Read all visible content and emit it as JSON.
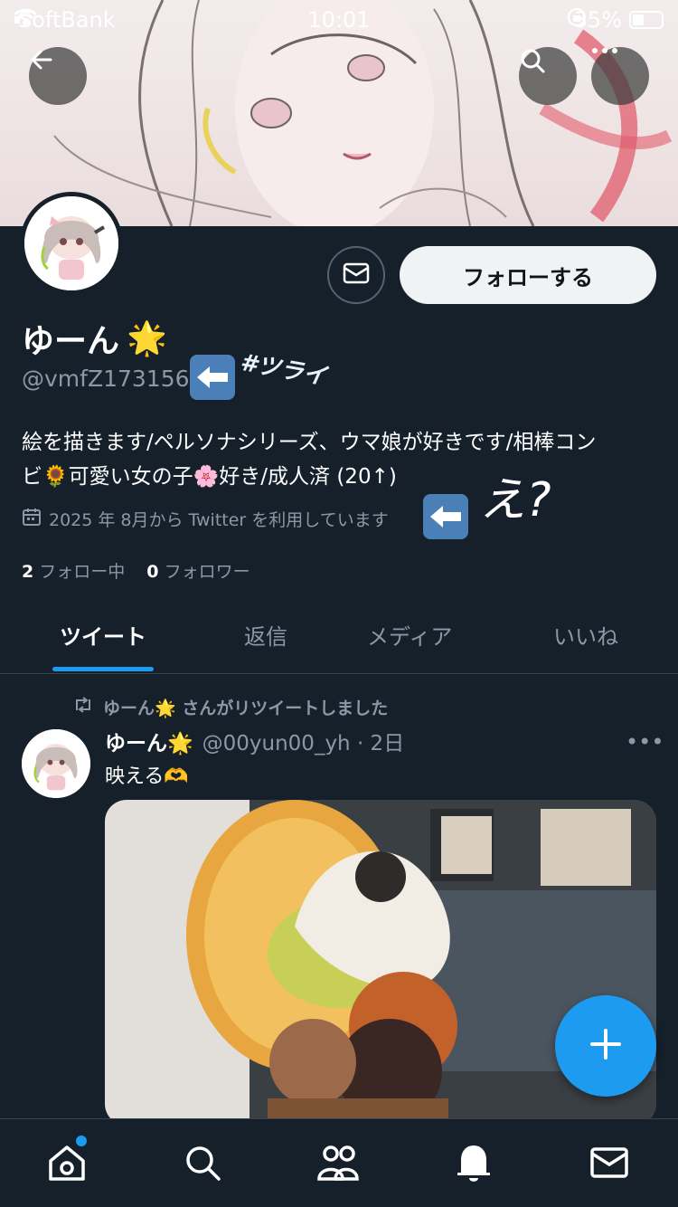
{
  "status_bar": {
    "carrier": "SoftBank",
    "time": "10:01",
    "battery": "35%"
  },
  "profile": {
    "display_name": "ゆーん",
    "name_emoji": "🌟",
    "handle": "@vmfZ173156",
    "scribble_tag": "#ツライ",
    "scribble_question": "え?",
    "bio_line1": "絵を描きます/ペルソナシリーズ、ウマ娘が好きです/相棒コン",
    "bio_line2": "ビ🌻可愛い女の子🌸好き/成人済 (20↑)",
    "joined": "2025 年 8月から Twitter を利用しています",
    "following_count": "2",
    "following_label": "フォロー中",
    "followers_count": "0",
    "followers_label": "フォロワー",
    "follow_button": "フォローする"
  },
  "tabs": [
    {
      "label": "ツイート",
      "active": true
    },
    {
      "label": "返信",
      "active": false
    },
    {
      "label": "メディア",
      "active": false
    },
    {
      "label": "いいね",
      "active": false
    }
  ],
  "tweet": {
    "retweet_notice": "ゆーん🌟 さんがリツイートしました",
    "author_name": "ゆーん🌟",
    "author_handle": "@00yun00_yh · 2日",
    "text": "映える🫶",
    "more": "•••"
  },
  "icons": {
    "back": "back-arrow-icon",
    "search": "search-icon",
    "more": "more-icon",
    "message": "mail-icon",
    "calendar": "calendar-icon",
    "retweet": "retweet-icon",
    "compose": "plus-icon",
    "nav": [
      "home-icon",
      "search-icon",
      "communities-icon",
      "notifications-icon",
      "messages-icon"
    ]
  },
  "colors": {
    "background": "#15202b",
    "accent": "#1d9bf0",
    "muted": "#8b98a5"
  }
}
